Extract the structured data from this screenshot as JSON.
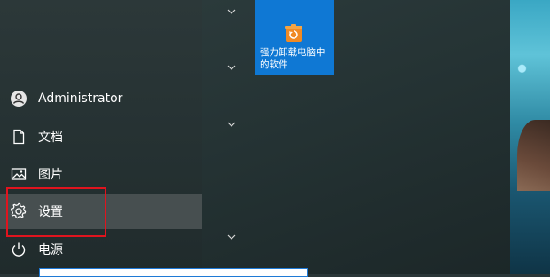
{
  "start_menu": {
    "nav": {
      "user": {
        "label": "Administrator",
        "icon": "user-avatar-icon"
      },
      "documents": {
        "label": "文档",
        "icon": "document-icon"
      },
      "pictures": {
        "label": "图片",
        "icon": "picture-icon"
      },
      "settings": {
        "label": "设置",
        "icon": "gear-icon",
        "active": true
      },
      "power": {
        "label": "电源",
        "icon": "power-icon"
      }
    },
    "tiles": [
      {
        "label": "强力卸载电脑中的软件",
        "icon": "uninstaller-app-icon",
        "color": "#0f78d4"
      }
    ],
    "group_chevrons": [
      "chevron-down-icon",
      "chevron-down-icon",
      "chevron-down-icon",
      "chevron-down-icon"
    ]
  },
  "annotation": {
    "highlight_color": "#e0141e",
    "target": "settings"
  },
  "colors": {
    "accent": "#0f78d4",
    "menu_bg": "#2c3839",
    "active_bg": "#474f50"
  }
}
